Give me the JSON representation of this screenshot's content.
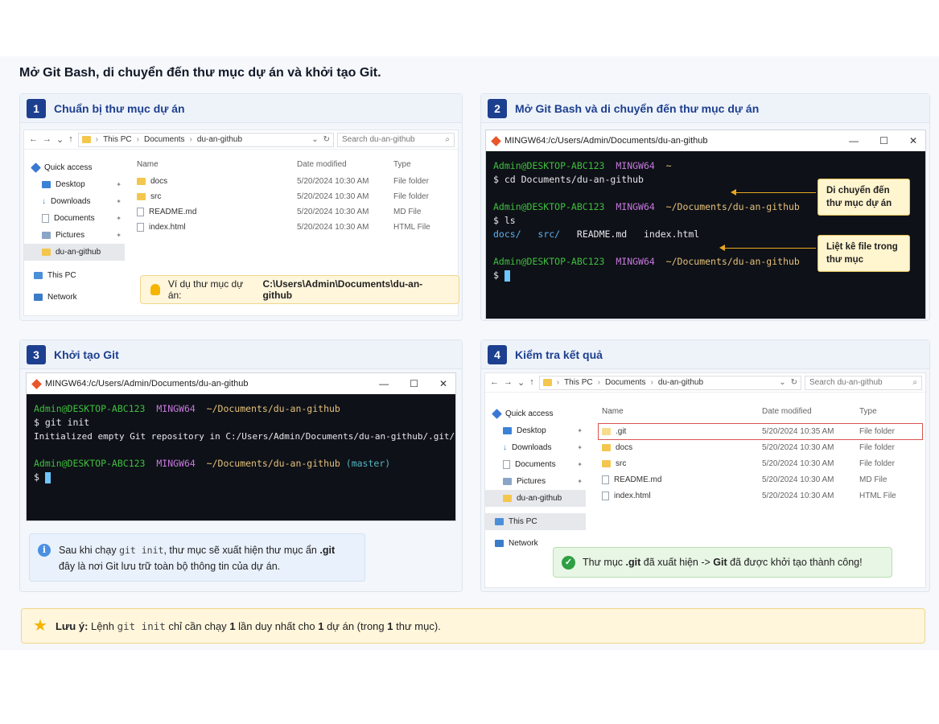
{
  "main_title": "Mở Git Bash, di chuyển đến thư mục dự án và khởi tạo Git.",
  "steps": [
    {
      "num": "1",
      "title": "Chuẩn bị thư mục dự án"
    },
    {
      "num": "2",
      "title": "Mở Git Bash và di chuyển đến thư mục dự án"
    },
    {
      "num": "3",
      "title": "Khởi tạo Git"
    },
    {
      "num": "4",
      "title": "Kiểm tra kết quả"
    }
  ],
  "explorer1": {
    "breadcrumb": [
      "This PC",
      "Documents",
      "du-an-github"
    ],
    "search_placeholder": "Search du-an-github",
    "sidebar": [
      "Quick access",
      "Desktop",
      "Downloads",
      "Documents",
      "Pictures",
      "du-an-github",
      "This PC",
      "Network"
    ],
    "headers": {
      "name": "Name",
      "date": "Date modified",
      "type": "Type"
    },
    "rows": [
      {
        "name": "docs",
        "date": "5/20/2024 10:30 AM",
        "type": "File folder"
      },
      {
        "name": "src",
        "date": "5/20/2024 10:30 AM",
        "type": "File folder"
      },
      {
        "name": "README.md",
        "date": "5/20/2024 10:30 AM",
        "type": "MD File"
      },
      {
        "name": "index.html",
        "date": "5/20/2024 10:30 AM",
        "type": "HTML File"
      }
    ],
    "example_label": "Ví dụ thư mục dự án:",
    "example_path": "C:\\Users\\Admin\\Documents\\du-an-github"
  },
  "terminal2": {
    "title": "MINGW64:/c/Users/Admin/Documents/du-an-github",
    "user": "Admin@DESKTOP-ABC123",
    "shell": "MINGW64",
    "home": "~",
    "path": "~/Documents/du-an-github",
    "cmd_cd": "$ cd Documents/du-an-github",
    "cmd_ls": "$ ls",
    "ls_output": [
      "docs/",
      "src/",
      "README.md",
      "index.html"
    ],
    "prompt": "$",
    "callout_cd": [
      "Di chuyển đến",
      "thư mục dự án"
    ],
    "callout_ls": [
      "Liệt kê file trong",
      "thư mục"
    ]
  },
  "terminal3": {
    "title": "MINGW64:/c/Users/Admin/Documents/du-an-github",
    "user": "Admin@DESKTOP-ABC123",
    "shell": "MINGW64",
    "path": "~/Documents/du-an-github",
    "cmd": "$ git init",
    "output": "Initialized empty Git repository in C:/Users/Admin/Documents/du-an-github/.git/",
    "branch": "(master)",
    "prompt": "$",
    "note_part1": "Sau khi chạy",
    "note_code": "git init",
    "note_part2": ", thư mục sẽ xuất hiện thư mục ẩn",
    "note_bold": ".git",
    "note_line2": "đây là nơi Git lưu trữ toàn bộ thông tin của dự án."
  },
  "explorer4": {
    "breadcrumb": [
      "This PC",
      "Documents",
      "du-an-github"
    ],
    "search_placeholder": "Search du-an-github",
    "sidebar": [
      "Quick access",
      "Desktop",
      "Downloads",
      "Documents",
      "Pictures",
      "du-an-github",
      "This PC",
      "Network"
    ],
    "headers": {
      "name": "Name",
      "date": "Date modified",
      "type": "Type"
    },
    "rows": [
      {
        "name": ".git",
        "date": "5/20/2024 10:35 AM",
        "type": "File folder"
      },
      {
        "name": "docs",
        "date": "5/20/2024 10:30 AM",
        "type": "File folder"
      },
      {
        "name": "src",
        "date": "5/20/2024 10:30 AM",
        "type": "File folder"
      },
      {
        "name": "README.md",
        "date": "5/20/2024 10:30 AM",
        "type": "MD File"
      },
      {
        "name": "index.html",
        "date": "5/20/2024 10:30 AM",
        "type": "HTML File"
      }
    ],
    "success_part1": "Thư mục",
    "success_git": ".git",
    "success_part2": "đã xuất hiện ->",
    "success_git2": "Git",
    "success_part3": "đã được khởi tạo thành công!"
  },
  "bottom_note": {
    "label": "Lưu ý:",
    "part1": "Lệnh",
    "code": "git init",
    "part2": "chỉ cần chạy",
    "bold1": "1",
    "part3": "lần duy nhất cho",
    "bold2": "1",
    "part4": "dự án (trong",
    "bold3": "1",
    "part5": "thư mục)."
  },
  "colors": {
    "accent": "#1d3f8f",
    "term_bg": "#0e1117",
    "prompt_green": "#3fbf3f",
    "prompt_magenta": "#c678dd",
    "path_yellow": "#e5c07b",
    "highlight_red": "#d9534f"
  },
  "window_controls": [
    "—",
    "☐",
    "✕"
  ],
  "nav_icons": [
    "←",
    "→",
    "⌄",
    "↑"
  ]
}
